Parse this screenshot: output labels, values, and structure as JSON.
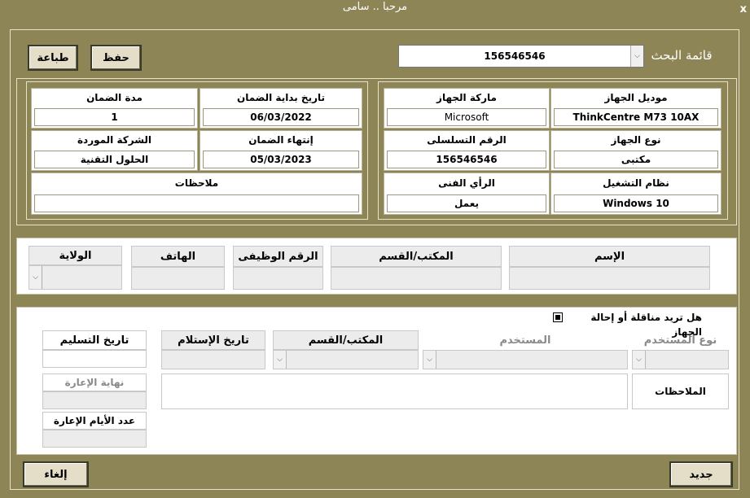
{
  "window": {
    "title": "مرحبا .. سامى",
    "close": "x"
  },
  "toolbar": {
    "print_label": "طباعة",
    "save_label": "حفظ",
    "search_label": "قائمة البحث",
    "search_value": "156546546"
  },
  "device": {
    "model_label": "موديل الجهاز",
    "model_value": "ThinkCentre M73 10AX",
    "brand_label": "ماركة الجهاز",
    "brand_value": "Microsoft",
    "type_label": "نوع الجهاز",
    "type_value": "مكتبى",
    "serial_label": "الرقم التسلسلى",
    "serial_value": "156546546",
    "os_label": "نظام التشغيل",
    "os_value": "Windows 10",
    "tech_label": "الرأي الفنى",
    "tech_value": "يعمل"
  },
  "warranty": {
    "start_label": "تاريخ بداية الضمان",
    "start_value": "06/03/2022",
    "duration_label": "مدة الضمان",
    "duration_value": "1",
    "end_label": "إنتهاء الضمان",
    "end_value": "05/03/2023",
    "supplier_label": "الشركة الموردة",
    "supplier_value": "الحلول التقنية",
    "notes_label": "ملاحظات",
    "notes_value": ""
  },
  "user": {
    "name_label": "الإسم",
    "office_label": "المكتب/القسم",
    "job_label": "الرقم الوظيفى",
    "phone_label": "الهاتف",
    "state_label": "الولاية"
  },
  "transfer": {
    "question": "هل تريد مناقلة أو إحالة الجهاز",
    "user_type_label": "نوع المستخدم",
    "user_label": "المستخدم",
    "office_label": "المكتب/القسم",
    "receive_label": "تاريخ الإستلام",
    "deliver_label": "تاريخ التسليم",
    "notes_label": "الملاحظات",
    "loan_end_label": "نهاية الإعارة",
    "loan_days_label": "عدد الأيام الإعارة"
  },
  "footer": {
    "new_label": "جديد",
    "cancel_label": "إلغاء"
  }
}
